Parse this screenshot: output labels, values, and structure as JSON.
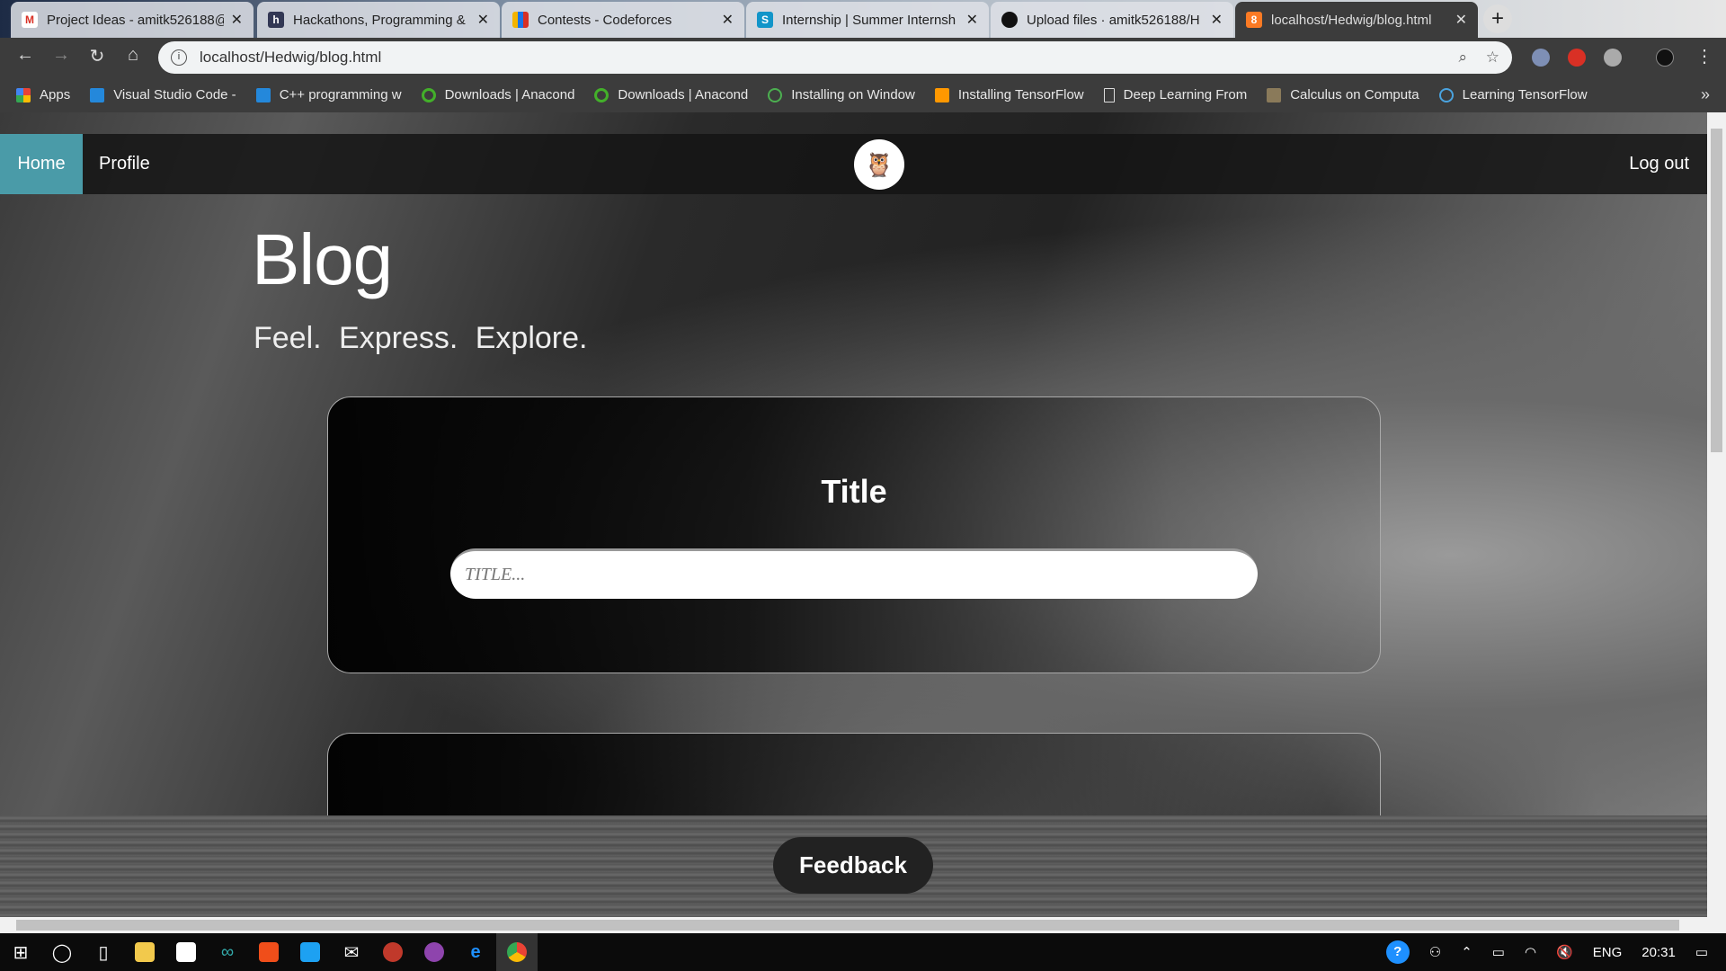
{
  "browser": {
    "tabs": [
      {
        "label": "Project Ideas - amitk526188@",
        "icon": "gmail-icon",
        "color": "#d93025",
        "active": false
      },
      {
        "label": "Hackathons, Programming &",
        "icon": "hackerearth-icon",
        "color": "#323754",
        "active": false
      },
      {
        "label": "Contests - Codeforces",
        "icon": "codeforces-icon",
        "color": "#1a73e8",
        "active": false
      },
      {
        "label": "Internship | Summer Internsh",
        "icon": "internshala-icon",
        "color": "#1295c9",
        "active": false
      },
      {
        "label": "Upload files · amitk526188/H",
        "icon": "github-icon",
        "color": "#111111",
        "active": false
      },
      {
        "label": "localhost/Hedwig/blog.html",
        "icon": "xampp-icon",
        "color": "#fb7a24",
        "active": true
      }
    ],
    "new_tab": "+",
    "url": "localhost/Hedwig/blog.html",
    "bookmarks": [
      {
        "label": "Apps",
        "color": "#ea4335"
      },
      {
        "label": "Visual Studio Code -",
        "color": "#2488db"
      },
      {
        "label": "C++ programming w",
        "color": "#2488db"
      },
      {
        "label": "Downloads | Anacond",
        "color": "#43b02a"
      },
      {
        "label": "Downloads | Anacond",
        "color": "#43b02a"
      },
      {
        "label": "Installing on Window",
        "color": "#4caf50"
      },
      {
        "label": "Installing TensorFlow",
        "color": "#ff9800"
      },
      {
        "label": "Deep Learning From",
        "color": "#dddddd"
      },
      {
        "label": "Calculus on Computa",
        "color": "#8a7a5a"
      },
      {
        "label": "Learning TensorFlow",
        "color": "#4aa3df"
      }
    ],
    "more": "»"
  },
  "site": {
    "nav": {
      "home": "Home",
      "profile": "Profile",
      "logout": "Log out"
    },
    "heading": "Blog",
    "tagline": "Feel.  Express.  Explore.",
    "card_title": "Title",
    "title_placeholder": "TITLE...",
    "feedback": "Feedback"
  },
  "taskbar": {
    "lang": "ENG",
    "time": "20:31"
  }
}
